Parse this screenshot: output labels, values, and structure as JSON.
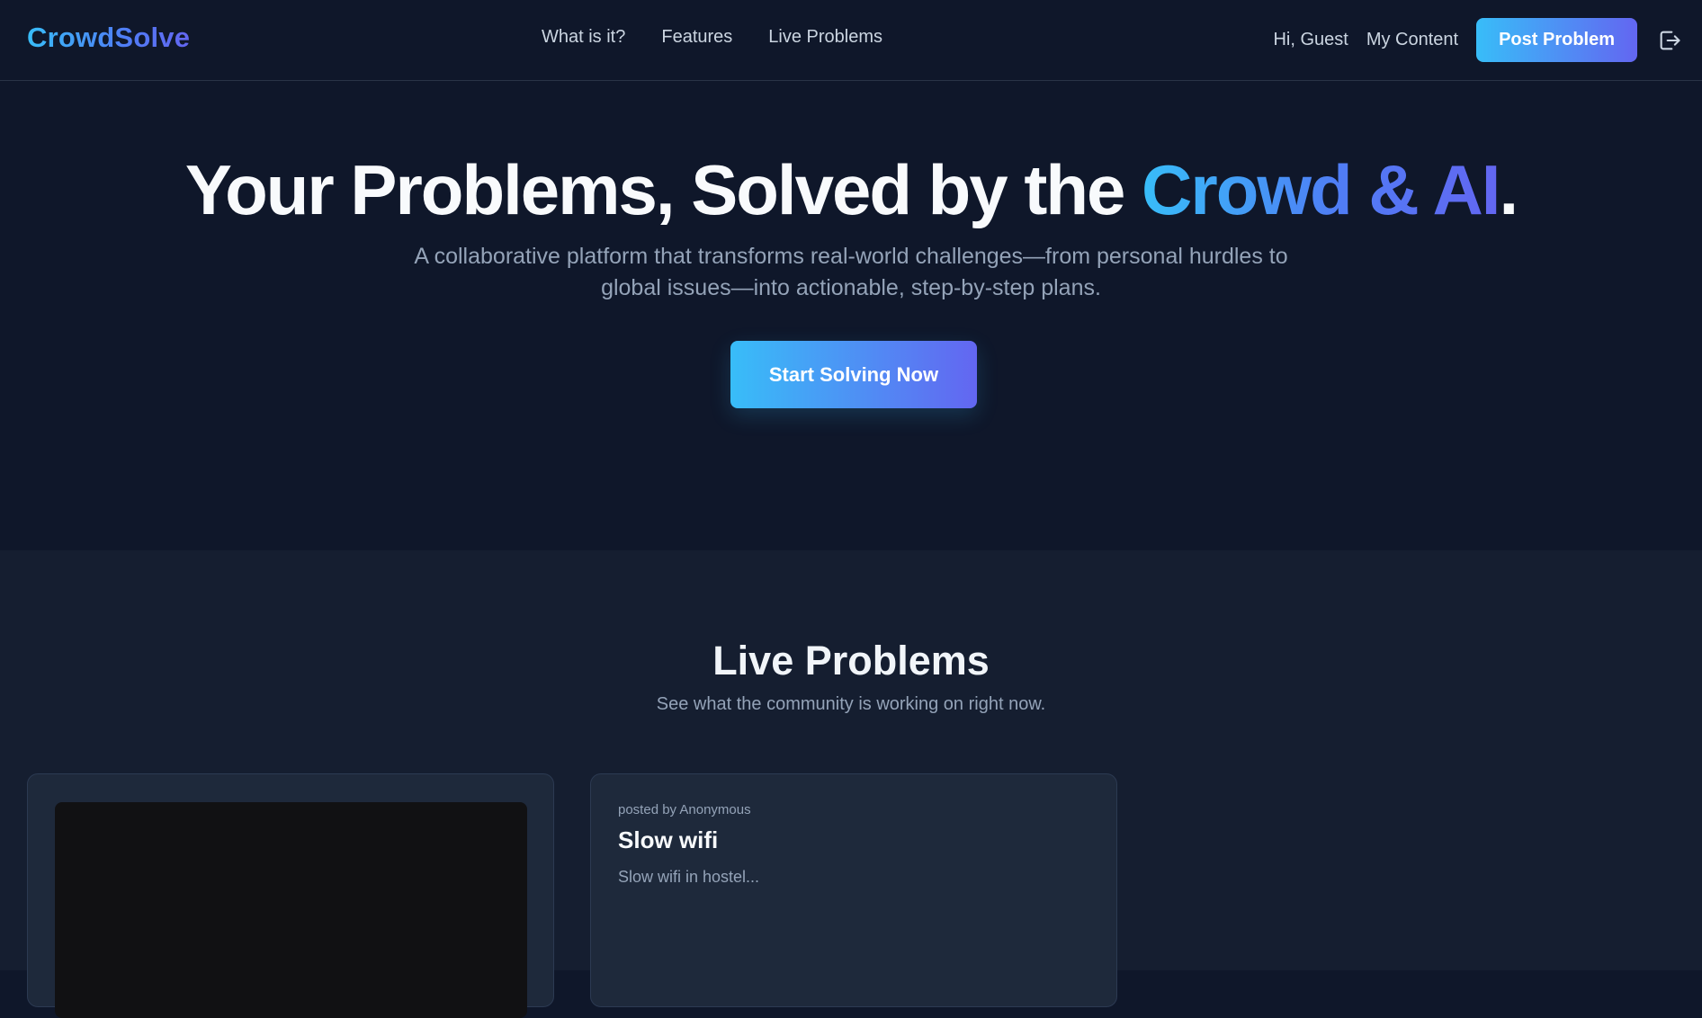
{
  "header": {
    "logo": "CrowdSolve",
    "nav": [
      "What is it?",
      "Features",
      "Live Problems"
    ],
    "greeting": "Hi, Guest",
    "my_content": "My Content",
    "post_button": "Post Problem",
    "logout_icon": "logout-icon"
  },
  "hero": {
    "title_plain": "Your Problems, Solved by the ",
    "title_highlight": "Crowd & AI",
    "title_end": ".",
    "subtitle": "A collaborative platform that transforms real-world challenges—from personal hurdles to global issues—into actionable, step-by-step plans.",
    "cta": "Start Solving Now"
  },
  "live_problems": {
    "title": "Live Problems",
    "subtitle": "See what the community is working on right now.",
    "cards": [
      {
        "has_media": true
      },
      {
        "posted_by": "posted by Anonymous",
        "title": "Slow wifi",
        "description": "Slow wifi in hostel..."
      }
    ]
  },
  "colors": {
    "background": "#0f172a",
    "section_background": "#151e30",
    "card_background": "#1e293b",
    "accent_start": "#38bdf8",
    "accent_end": "#6366f1"
  }
}
